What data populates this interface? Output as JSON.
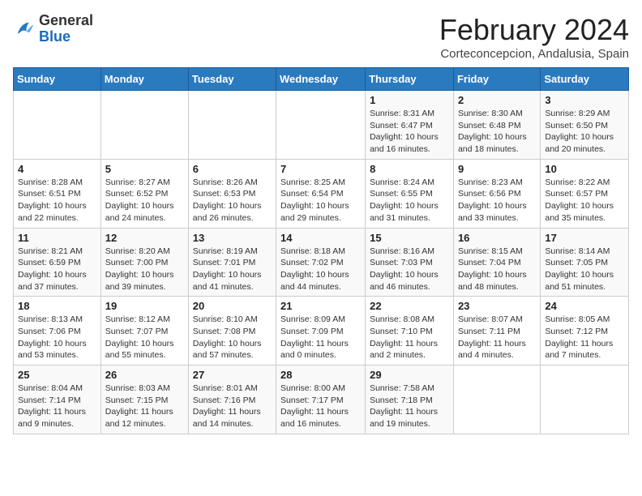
{
  "logo": {
    "general": "General",
    "blue": "Blue"
  },
  "header": {
    "title": "February 2024",
    "subtitle": "Corteconcepcion, Andalusia, Spain"
  },
  "days": [
    "Sunday",
    "Monday",
    "Tuesday",
    "Wednesday",
    "Thursday",
    "Friday",
    "Saturday"
  ],
  "weeks": [
    [
      {
        "date": "",
        "info": ""
      },
      {
        "date": "",
        "info": ""
      },
      {
        "date": "",
        "info": ""
      },
      {
        "date": "",
        "info": ""
      },
      {
        "date": "1",
        "info": "Sunrise: 8:31 AM\nSunset: 6:47 PM\nDaylight: 10 hours and 16 minutes."
      },
      {
        "date": "2",
        "info": "Sunrise: 8:30 AM\nSunset: 6:48 PM\nDaylight: 10 hours and 18 minutes."
      },
      {
        "date": "3",
        "info": "Sunrise: 8:29 AM\nSunset: 6:50 PM\nDaylight: 10 hours and 20 minutes."
      }
    ],
    [
      {
        "date": "4",
        "info": "Sunrise: 8:28 AM\nSunset: 6:51 PM\nDaylight: 10 hours and 22 minutes."
      },
      {
        "date": "5",
        "info": "Sunrise: 8:27 AM\nSunset: 6:52 PM\nDaylight: 10 hours and 24 minutes."
      },
      {
        "date": "6",
        "info": "Sunrise: 8:26 AM\nSunset: 6:53 PM\nDaylight: 10 hours and 26 minutes."
      },
      {
        "date": "7",
        "info": "Sunrise: 8:25 AM\nSunset: 6:54 PM\nDaylight: 10 hours and 29 minutes."
      },
      {
        "date": "8",
        "info": "Sunrise: 8:24 AM\nSunset: 6:55 PM\nDaylight: 10 hours and 31 minutes."
      },
      {
        "date": "9",
        "info": "Sunrise: 8:23 AM\nSunset: 6:56 PM\nDaylight: 10 hours and 33 minutes."
      },
      {
        "date": "10",
        "info": "Sunrise: 8:22 AM\nSunset: 6:57 PM\nDaylight: 10 hours and 35 minutes."
      }
    ],
    [
      {
        "date": "11",
        "info": "Sunrise: 8:21 AM\nSunset: 6:59 PM\nDaylight: 10 hours and 37 minutes."
      },
      {
        "date": "12",
        "info": "Sunrise: 8:20 AM\nSunset: 7:00 PM\nDaylight: 10 hours and 39 minutes."
      },
      {
        "date": "13",
        "info": "Sunrise: 8:19 AM\nSunset: 7:01 PM\nDaylight: 10 hours and 41 minutes."
      },
      {
        "date": "14",
        "info": "Sunrise: 8:18 AM\nSunset: 7:02 PM\nDaylight: 10 hours and 44 minutes."
      },
      {
        "date": "15",
        "info": "Sunrise: 8:16 AM\nSunset: 7:03 PM\nDaylight: 10 hours and 46 minutes."
      },
      {
        "date": "16",
        "info": "Sunrise: 8:15 AM\nSunset: 7:04 PM\nDaylight: 10 hours and 48 minutes."
      },
      {
        "date": "17",
        "info": "Sunrise: 8:14 AM\nSunset: 7:05 PM\nDaylight: 10 hours and 51 minutes."
      }
    ],
    [
      {
        "date": "18",
        "info": "Sunrise: 8:13 AM\nSunset: 7:06 PM\nDaylight: 10 hours and 53 minutes."
      },
      {
        "date": "19",
        "info": "Sunrise: 8:12 AM\nSunset: 7:07 PM\nDaylight: 10 hours and 55 minutes."
      },
      {
        "date": "20",
        "info": "Sunrise: 8:10 AM\nSunset: 7:08 PM\nDaylight: 10 hours and 57 minutes."
      },
      {
        "date": "21",
        "info": "Sunrise: 8:09 AM\nSunset: 7:09 PM\nDaylight: 11 hours and 0 minutes."
      },
      {
        "date": "22",
        "info": "Sunrise: 8:08 AM\nSunset: 7:10 PM\nDaylight: 11 hours and 2 minutes."
      },
      {
        "date": "23",
        "info": "Sunrise: 8:07 AM\nSunset: 7:11 PM\nDaylight: 11 hours and 4 minutes."
      },
      {
        "date": "24",
        "info": "Sunrise: 8:05 AM\nSunset: 7:12 PM\nDaylight: 11 hours and 7 minutes."
      }
    ],
    [
      {
        "date": "25",
        "info": "Sunrise: 8:04 AM\nSunset: 7:14 PM\nDaylight: 11 hours and 9 minutes."
      },
      {
        "date": "26",
        "info": "Sunrise: 8:03 AM\nSunset: 7:15 PM\nDaylight: 11 hours and 12 minutes."
      },
      {
        "date": "27",
        "info": "Sunrise: 8:01 AM\nSunset: 7:16 PM\nDaylight: 11 hours and 14 minutes."
      },
      {
        "date": "28",
        "info": "Sunrise: 8:00 AM\nSunset: 7:17 PM\nDaylight: 11 hours and 16 minutes."
      },
      {
        "date": "29",
        "info": "Sunrise: 7:58 AM\nSunset: 7:18 PM\nDaylight: 11 hours and 19 minutes."
      },
      {
        "date": "",
        "info": ""
      },
      {
        "date": "",
        "info": ""
      }
    ]
  ]
}
